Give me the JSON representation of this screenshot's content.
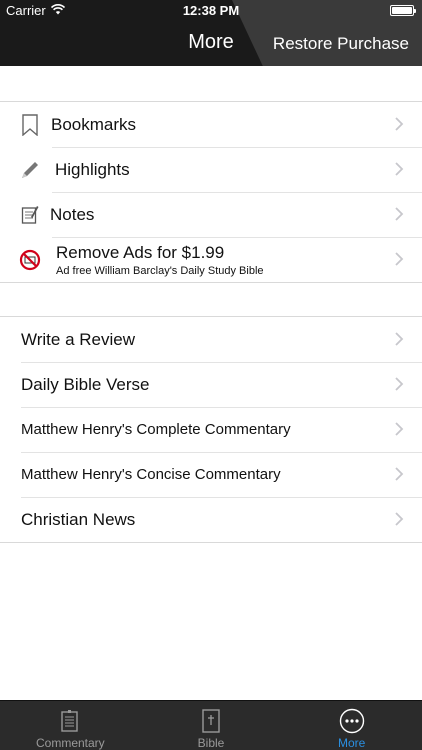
{
  "status_bar": {
    "carrier": "Carrier",
    "time": "12:38 PM"
  },
  "nav": {
    "title": "More",
    "right_button": "Restore Purchase"
  },
  "group1": [
    {
      "label": "Bookmarks",
      "icon": "bookmark-icon"
    },
    {
      "label": "Highlights",
      "icon": "pencil-icon"
    },
    {
      "label": "Notes",
      "icon": "notepad-icon"
    },
    {
      "label": "Remove Ads for $1.99",
      "sublabel": "Ad free William Barclay's Daily Study Bible",
      "icon": "no-ads-icon"
    }
  ],
  "group2": [
    {
      "label": "Write a Review"
    },
    {
      "label": "Daily Bible Verse"
    },
    {
      "label": "Matthew Henry's Complete Commentary"
    },
    {
      "label": "Matthew Henry's Concise Commentary"
    },
    {
      "label": "Christian News"
    }
  ],
  "tabs": [
    {
      "label": "Commentary",
      "icon": "commentary-icon",
      "active": false
    },
    {
      "label": "Bible",
      "icon": "bible-icon",
      "active": false
    },
    {
      "label": "More",
      "icon": "more-icon",
      "active": true
    }
  ],
  "colors": {
    "accent": "#2a8fe0",
    "header_bg": "#1a1a1a",
    "tabbar_bg": "#2b2b2b"
  }
}
